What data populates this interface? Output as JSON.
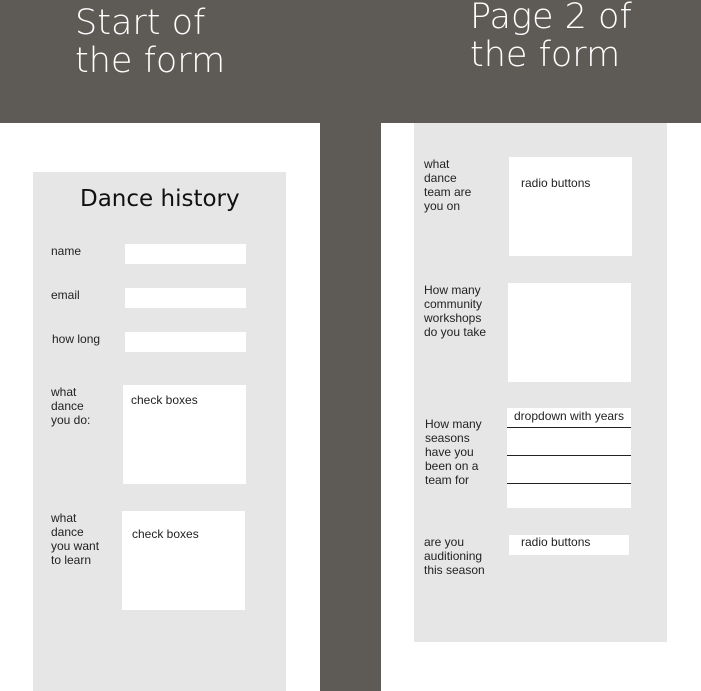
{
  "headings": {
    "left": "Start of\nthe form",
    "right": "Page 2 of\nthe form"
  },
  "page1": {
    "title": "Dance history",
    "fields": [
      {
        "label": "name"
      },
      {
        "label": "email"
      },
      {
        "label": "how long"
      },
      {
        "label": "what\ndance\nyou do:",
        "content": "check boxes"
      },
      {
        "label": "what\ndance\nyou want\nto learn",
        "content": "check boxes"
      }
    ]
  },
  "page2": {
    "fields": [
      {
        "label": "what\ndance\nteam are\nyou on",
        "content": "radio buttons"
      },
      {
        "label": "How many\ncommunity\nworkshops\ndo you take"
      },
      {
        "label": "How many\nseasons\nhave you\nbeen on a\nteam for",
        "content": "dropdown with years"
      },
      {
        "label": "are you\nauditioning\nthis season",
        "content": "radio buttons"
      }
    ]
  },
  "colors": {
    "banner": "#5e5b57",
    "panel": "#e6e6e6",
    "field": "#ffffff"
  }
}
